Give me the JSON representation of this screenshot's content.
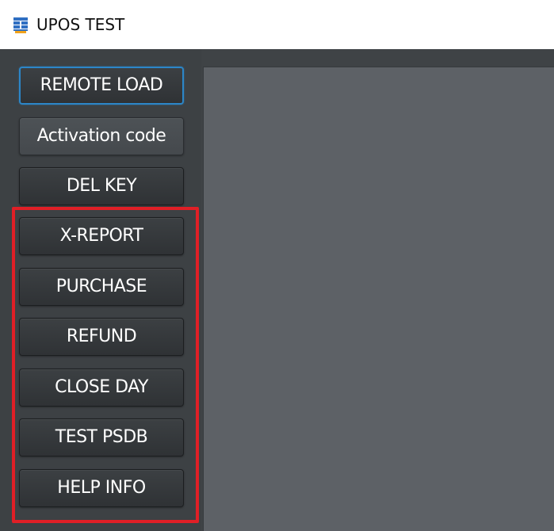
{
  "window": {
    "title": "UPOS TEST",
    "icon": "app-grid-icon"
  },
  "sidebar": {
    "buttons": [
      {
        "label": "REMOTE LOAD",
        "state": "focused"
      },
      {
        "label": "Activation code",
        "state": "normal"
      },
      {
        "label": "DEL KEY",
        "state": "normal"
      },
      {
        "label": "X-REPORT",
        "state": "normal"
      },
      {
        "label": "PURCHASE",
        "state": "normal"
      },
      {
        "label": "REFUND",
        "state": "normal"
      },
      {
        "label": "CLOSE DAY",
        "state": "normal"
      },
      {
        "label": "TEST PSDB",
        "state": "normal"
      },
      {
        "label": "HELP INFO",
        "state": "normal"
      }
    ]
  },
  "colors": {
    "focus_outline": "#2c86c8",
    "highlight": "#e01f26",
    "panel_background": "#5d6166",
    "sidebar_background": "#3d4144"
  }
}
